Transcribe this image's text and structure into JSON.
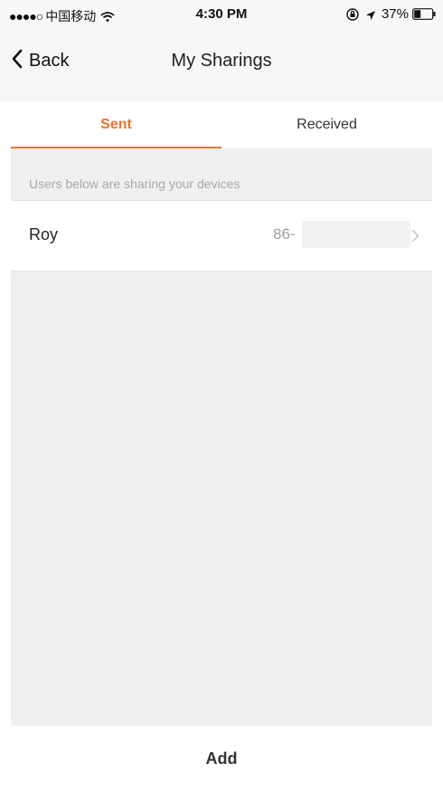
{
  "status_bar": {
    "signal": "●●●●○",
    "carrier": "中国移动",
    "time": "4:30 PM",
    "battery_percent": "37%",
    "battery_level": 0.37,
    "icons": [
      "wifi-icon",
      "rotation-lock-icon",
      "location-arrow-icon",
      "battery-icon"
    ]
  },
  "nav": {
    "back_label": "Back",
    "title": "My Sharings"
  },
  "tabs": [
    {
      "label": "Sent",
      "selected": true
    },
    {
      "label": "Received",
      "selected": false
    }
  ],
  "section": {
    "header": "Users below are sharing your devices"
  },
  "shares": [
    {
      "name": "Roy",
      "phone_prefix": "86-"
    }
  ],
  "actions": {
    "add_label": "Add"
  },
  "colors": {
    "accent": "#e8742b",
    "background": "#f0f0f0",
    "secondary_text": "#a8a8a8"
  }
}
